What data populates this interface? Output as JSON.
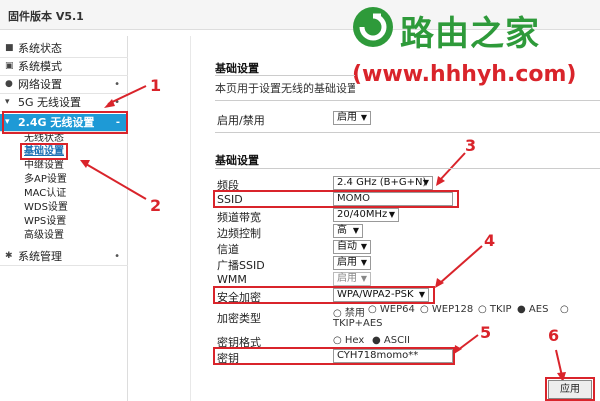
{
  "header": {
    "firmware_label": "固件版本 V5.1"
  },
  "watermark": {
    "brand": "路由之家",
    "url": "(www.hhhyh.com)"
  },
  "sidebar": {
    "items": [
      {
        "label": "系统状态",
        "icon": "grid-icon"
      },
      {
        "label": "系统模式",
        "icon": "window-icon"
      },
      {
        "label": "网络设置",
        "icon": "globe-icon"
      },
      {
        "label": "5G 无线设置",
        "icon": "wifi-icon"
      },
      {
        "label": "2.4G 无线设置",
        "icon": "wifi-icon"
      }
    ],
    "sub_items": [
      "无线状态",
      "基础设置",
      "中继设置",
      "多AP设置",
      "MAC认证",
      "WDS设置",
      "WPS设置",
      "高级设置"
    ],
    "bottom_item": {
      "label": "系统管理",
      "icon": "gear-icon"
    }
  },
  "main": {
    "section1_title": "基础设置",
    "description": "本页用于设置无线的基础设置",
    "enable_label": "启用/禁用",
    "enable_value": "启用",
    "section2_title": "基础设置",
    "fields": {
      "band": {
        "label": "频段",
        "value": "2.4 GHz (B+G+N)"
      },
      "ssid": {
        "label": "SSID",
        "value": "MOMO"
      },
      "bandwidth": {
        "label": "频道带宽",
        "value": "20/40MHz"
      },
      "sideband": {
        "label": "边频控制",
        "value": "高"
      },
      "channel": {
        "label": "信道",
        "value": "自动"
      },
      "broadcast": {
        "label": "广播SSID",
        "value": "启用"
      },
      "wmm": {
        "label": "WMM",
        "value": "启用"
      },
      "security": {
        "label": "安全加密",
        "value": "WPA/WPA2-PSK"
      },
      "encryption": {
        "label": "加密类型",
        "options": [
          "禁用",
          "WEP64",
          "WEP128",
          "TKIP",
          "AES",
          "TKIP+AES"
        ],
        "selected": "AES"
      },
      "key_format": {
        "label": "密钥格式",
        "options": [
          "Hex",
          "ASCII"
        ],
        "selected": "ASCII"
      },
      "key": {
        "label": "密钥",
        "value": "CYH718momo**"
      }
    },
    "apply_label": "应用"
  },
  "annotations": [
    "1",
    "2",
    "3",
    "4",
    "5",
    "6"
  ],
  "colors": {
    "accent": "#1e9ad6",
    "annotation": "#d9242b",
    "logo_green": "#2e9a3a"
  }
}
